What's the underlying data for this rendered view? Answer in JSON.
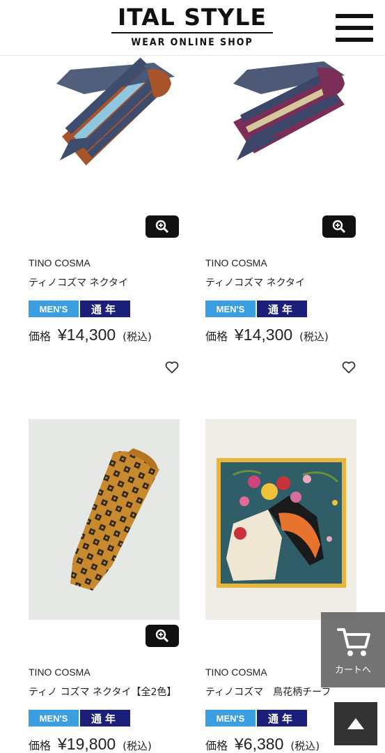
{
  "header": {
    "logo_main": "ITAL STYLE",
    "logo_sub": "WEAR ONLINE SHOP"
  },
  "products": [
    {
      "brand": "TINO COSMA",
      "name": "ティノコズマ ネクタイ",
      "badge_gender": "MEN'S",
      "badge_season": "通年",
      "price_label": "価格",
      "price": "¥14,300",
      "tax_note": "(税込)",
      "image": "navy-rust-striped-tie"
    },
    {
      "brand": "TINO COSMA",
      "name": "ティノコズマ ネクタイ",
      "badge_gender": "MEN'S",
      "badge_season": "通年",
      "price_label": "価格",
      "price": "¥14,300",
      "tax_note": "(税込)",
      "image": "navy-burgundy-striped-tie"
    },
    {
      "brand": "TINO COSMA",
      "name": "ティノ コズマ ネクタイ【全2色】",
      "badge_gender": "MEN'S",
      "badge_season": "通年",
      "price_label": "価格",
      "price": "¥19,800",
      "tax_note": "(税込)",
      "image": "mustard-foulard-tie"
    },
    {
      "brand": "TINO COSMA",
      "name": "ティノコズマ　鳥花柄チーフ",
      "badge_gender": "MEN'S",
      "badge_season": "通年",
      "price_label": "価格",
      "price": "¥6,380",
      "tax_note": "(税込)",
      "image": "toucan-floral-pocket-square"
    }
  ],
  "floating": {
    "cart_label": "カートへ"
  },
  "colors": {
    "badge_mens": "#3a9ee0",
    "badge_season": "#1b1f7a",
    "zoom_button": "#111111"
  }
}
